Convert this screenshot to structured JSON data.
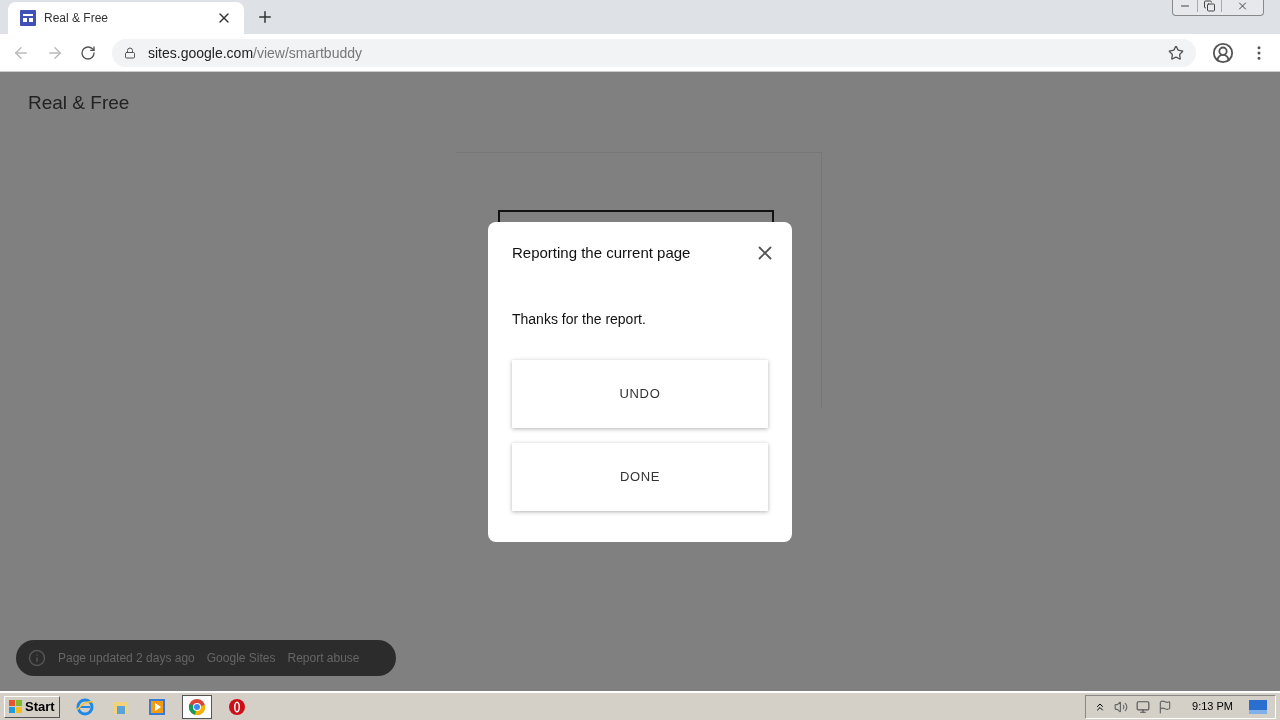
{
  "browser": {
    "tab": {
      "title": "Real & Free"
    },
    "address": {
      "host": "sites.google.com",
      "path": "/view/smartbuddy"
    }
  },
  "site": {
    "title": "Real & Free"
  },
  "dialog": {
    "title": "Reporting the current page",
    "message": "Thanks for the report.",
    "buttons": [
      "UNDO",
      "DONE"
    ]
  },
  "footer": {
    "items": [
      "Page updated 2 days ago",
      "Google Sites",
      "Report abuse"
    ]
  },
  "taskbar": {
    "start": "Start",
    "apps": [
      {
        "kind": "ie",
        "selected": false
      },
      {
        "kind": "folder",
        "selected": false
      },
      {
        "kind": "media",
        "selected": false
      },
      {
        "kind": "chrome",
        "selected": true
      },
      {
        "kind": "opera",
        "selected": false
      }
    ],
    "clock": "9:13 PM"
  }
}
